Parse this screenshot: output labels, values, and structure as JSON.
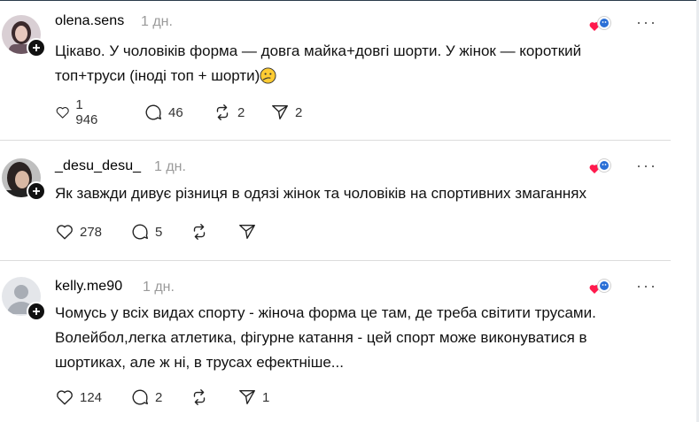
{
  "posts": [
    {
      "username": "olena.sens",
      "time": "1 дн.",
      "text_lines": [
        "Цікаво. У чоловіків форма — довга майка+довгі шорти. У жінок — короткий",
        "топ+труси (іноді топ + шорти)"
      ],
      "emoji": "thinking-face-emoji",
      "likes": "1 946",
      "comments": "46",
      "reposts": "2",
      "shares": "2",
      "avatar": "woman-portrait"
    },
    {
      "username": "_desu_desu_",
      "time": "1 дн.",
      "text_lines": [
        "Як завжди дивує різниця в одязі жінок та чоловіків на спортивних змаганнях"
      ],
      "likes": "278",
      "comments": "5",
      "reposts": "",
      "shares": "",
      "avatar": "woman-portrait"
    },
    {
      "username": "kelly.me90",
      "time": "1 дн.",
      "text_lines": [
        "Чомусь у всіх видах спорту - жіноча форма це там, де треба світити трусами.",
        "Волейбол,легка атлетика, фігурне катання - цей спорт може виконуватися в",
        "шортиках, але ж ні, в трусах ефектніше..."
      ],
      "likes": "124",
      "comments": "2",
      "reposts": "",
      "shares": "1",
      "avatar": "default-avatar"
    }
  ],
  "icons": {
    "like": "heart-outline-icon",
    "comment": "speech-bubble-icon",
    "repost": "repost-arrows-icon",
    "share": "send-paper-plane-icon",
    "more": "more-dots-icon",
    "reaction": "heart-and-smiley-reaction-icon"
  },
  "more_label": "···",
  "colors": {
    "heart_red": "#ff1a4d",
    "time_gray": "#9a9a9a",
    "divider": "#dcdcdc"
  }
}
